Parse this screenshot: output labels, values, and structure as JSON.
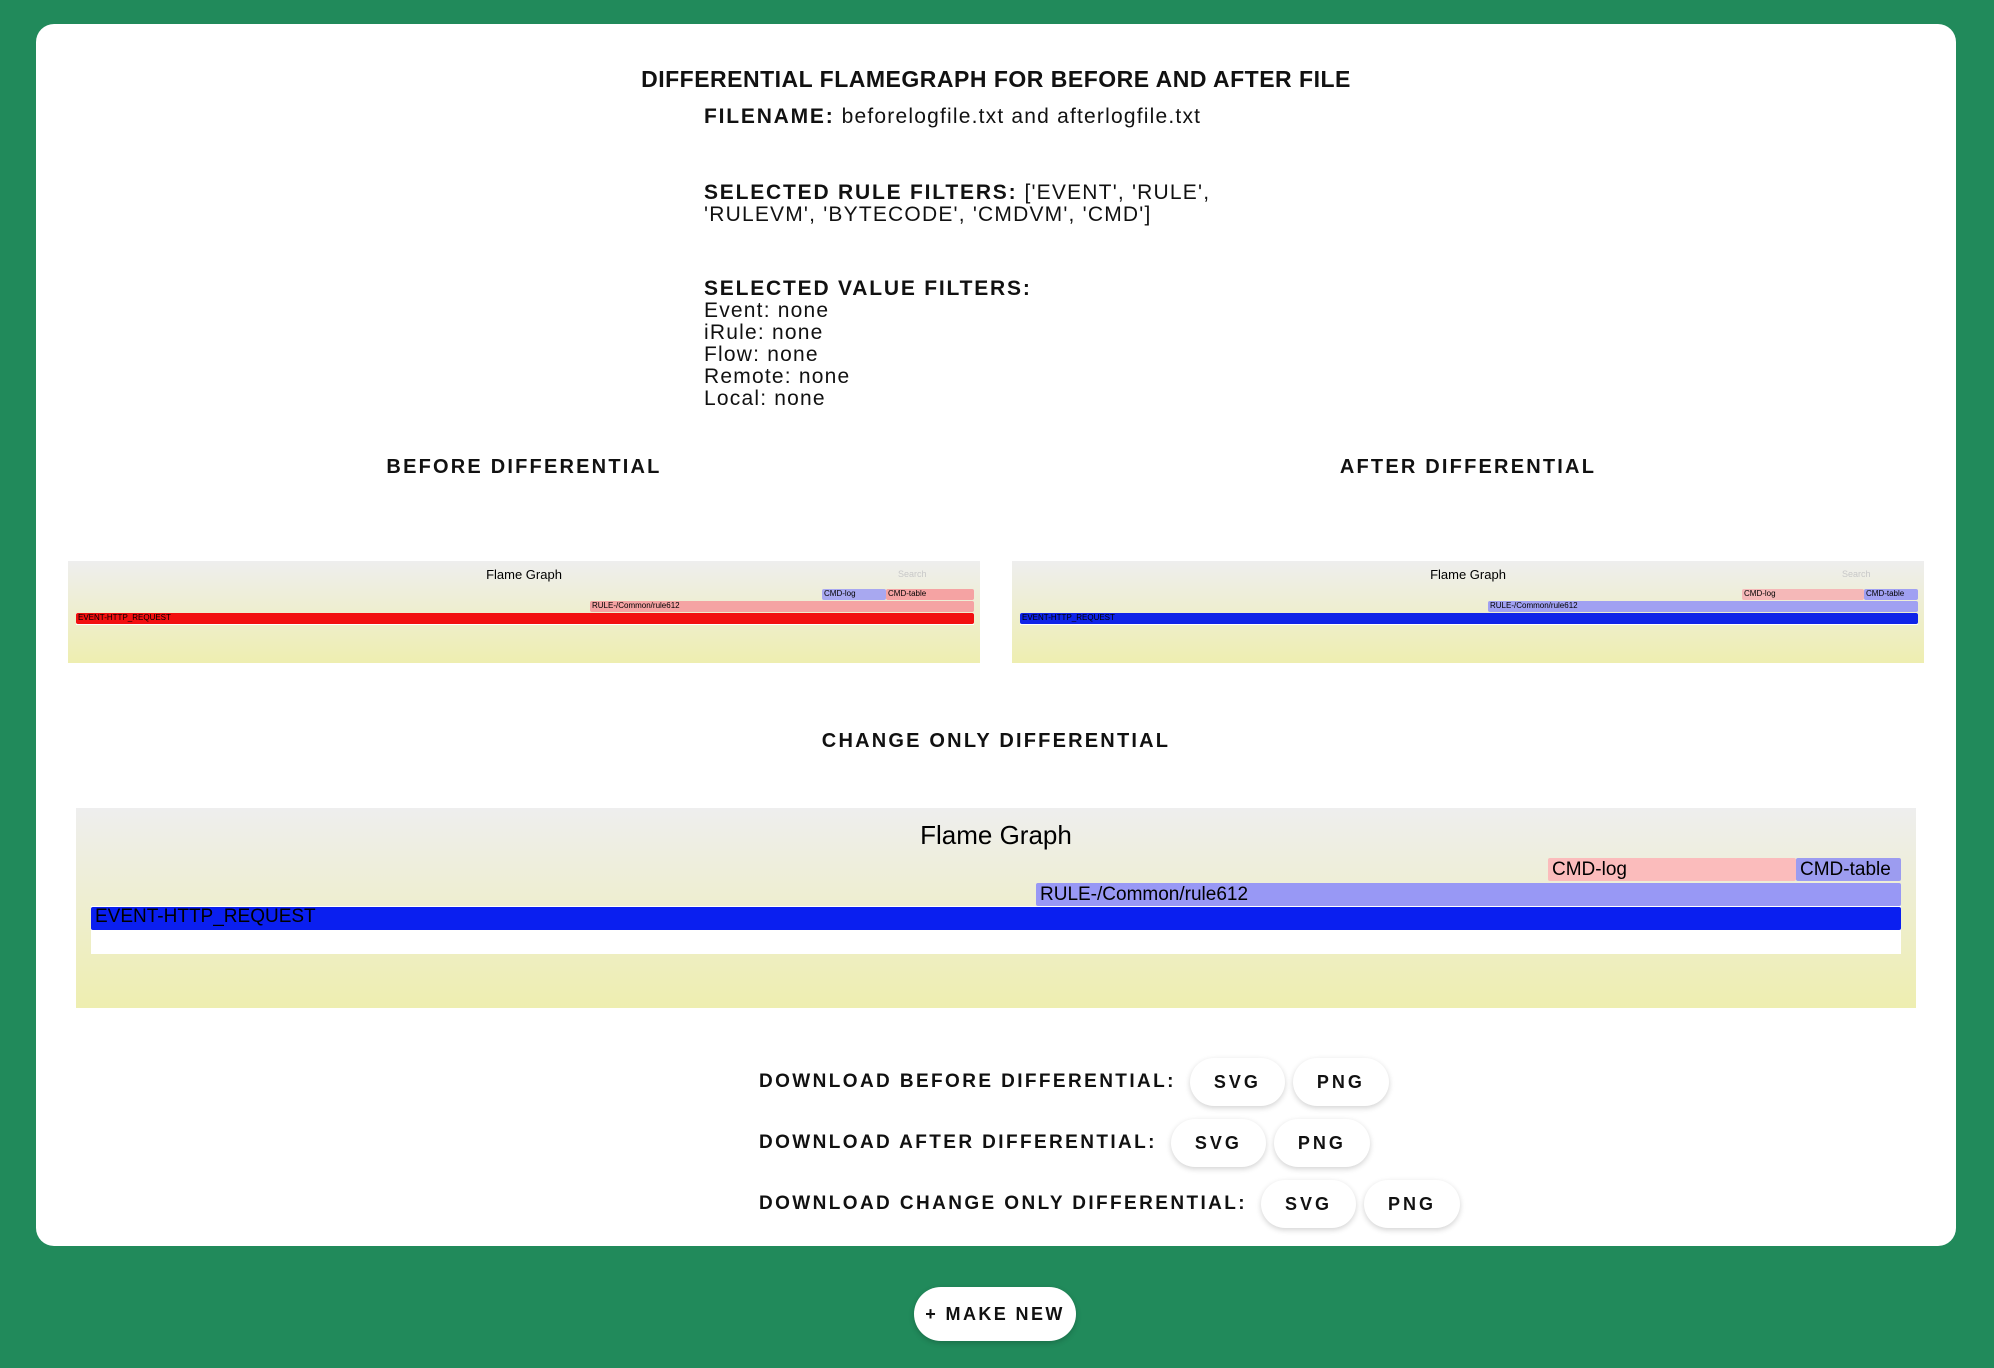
{
  "page": {
    "title": "DIFFERENTIAL FLAMEGRAPH FOR BEFORE AND AFTER FILE"
  },
  "info": {
    "filename_label": "FILENAME:",
    "filename_value": "beforelogfile.txt and afterlogfile.txt",
    "rule_filters_label": "SELECTED RULE FILTERS:",
    "rule_filters_value_line1": "['EVENT', 'RULE',",
    "rule_filters_value_line2": "'RULEVM', 'BYTECODE', 'CMDVM', 'CMD']",
    "value_filters_label": "SELECTED VALUE FILTERS:",
    "value_filters": [
      {
        "label": "Event:",
        "value": "none"
      },
      {
        "label": "iRule:",
        "value": "none"
      },
      {
        "label": "Flow:",
        "value": "none"
      },
      {
        "label": "Remote:",
        "value": "none"
      },
      {
        "label": "Local:",
        "value": "none"
      }
    ]
  },
  "sections": {
    "before": "BEFORE DIFFERENTIAL",
    "after": "AFTER DIFFERENTIAL",
    "change": "CHANGE ONLY DIFFERENTIAL"
  },
  "flamegraphs": {
    "before": {
      "title": "Flame Graph",
      "search": "Search",
      "frames": {
        "cmd_log": {
          "label": "CMD-log",
          "color": "#a8a8f0"
        },
        "cmd_table": {
          "label": "CMD-table",
          "color": "#f5a3a3"
        },
        "rule": {
          "label": "RULE-/Common/rule612",
          "color": "#f5a3a3"
        },
        "event": {
          "label": "EVENT-HTTP_REQUEST",
          "color": "#f21010"
        }
      }
    },
    "after": {
      "title": "Flame Graph",
      "search": "Search",
      "frames": {
        "cmd_log": {
          "label": "CMD-log",
          "color": "#f5b8b8"
        },
        "cmd_table": {
          "label": "CMD-table",
          "color": "#a0a0f2"
        },
        "rule": {
          "label": "RULE-/Common/rule612",
          "color": "#a0a0f2"
        },
        "event": {
          "label": "EVENT-HTTP_REQUEST",
          "color": "#1024e8"
        }
      }
    },
    "change": {
      "title": "Flame Graph",
      "frames": {
        "cmd_log": {
          "label": "CMD-log",
          "color": "#fbbcbc"
        },
        "cmd_table": {
          "label": "CMD-table",
          "color": "#9c9cf0"
        },
        "rule": {
          "label": "RULE-/Common/rule612",
          "color": "#9898f5"
        },
        "event": {
          "label": "EVENT-HTTP_REQUEST",
          "color": "#0a1ff0"
        }
      }
    }
  },
  "downloads": [
    {
      "label": "DOWNLOAD BEFORE DIFFERENTIAL:",
      "svg": "SVG",
      "png": "PNG"
    },
    {
      "label": "DOWNLOAD AFTER DIFFERENTIAL:",
      "svg": "SVG",
      "png": "PNG"
    },
    {
      "label": "DOWNLOAD CHANGE ONLY DIFFERENTIAL:",
      "svg": "SVG",
      "png": "PNG"
    }
  ],
  "make_new": "+ MAKE NEW"
}
